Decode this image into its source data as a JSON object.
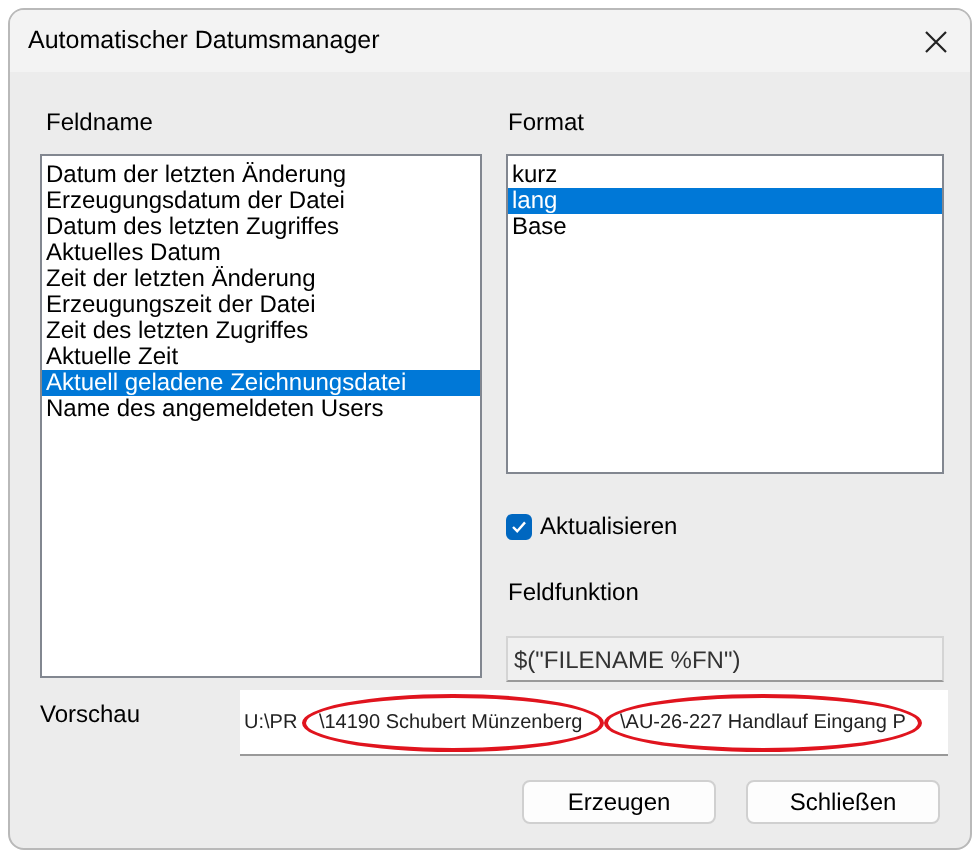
{
  "window": {
    "title": "Automatischer Datumsmanager"
  },
  "feldname": {
    "label": "Feldname",
    "items": [
      {
        "label": "Datum der letzten Änderung",
        "selected": false
      },
      {
        "label": "Erzeugungsdatum der Datei",
        "selected": false
      },
      {
        "label": "Datum des letzten Zugriffes",
        "selected": false
      },
      {
        "label": "Aktuelles Datum",
        "selected": false
      },
      {
        "label": "Zeit der letzten Änderung",
        "selected": false
      },
      {
        "label": "Erzeugungszeit der Datei",
        "selected": false
      },
      {
        "label": "Zeit des letzten Zugriffes",
        "selected": false
      },
      {
        "label": "Aktuelle Zeit",
        "selected": false
      },
      {
        "label": "Aktuell geladene Zeichnungsdatei",
        "selected": true
      },
      {
        "label": "Name des angemeldeten Users",
        "selected": false
      }
    ]
  },
  "format": {
    "label": "Format",
    "items": [
      {
        "label": "kurz",
        "selected": false
      },
      {
        "label": "lang",
        "selected": true
      },
      {
        "label": "Base",
        "selected": false
      }
    ]
  },
  "aktualisieren": {
    "label": "Aktualisieren",
    "checked": true
  },
  "feldfunktion": {
    "label": "Feldfunktion",
    "value": "$(\"FILENAME %FN\")"
  },
  "vorschau": {
    "label": "Vorschau",
    "segments": [
      {
        "text": "U:\\PR ",
        "circled": false
      },
      {
        "text": "\\14190 Schubert Münzenberg ",
        "circled": true
      },
      {
        "text": "\\AU-26-227 Handlauf Eingang P",
        "circled": true
      }
    ]
  },
  "buttons": [
    "Erzeugen",
    "Schließen"
  ]
}
